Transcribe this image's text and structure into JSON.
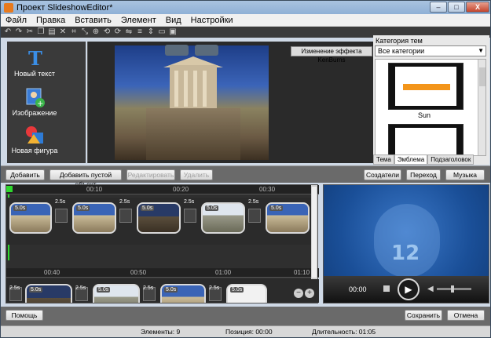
{
  "window": {
    "title": "Проект SlideshowEditor*",
    "min_label": "–",
    "max_label": "□",
    "close_label": "X"
  },
  "menu": [
    "Файл",
    "Правка",
    "Вставить",
    "Элемент",
    "Вид",
    "Настройки"
  ],
  "toolbar_icons": [
    "undo-icon",
    "redo-icon",
    "cut-icon",
    "copy-icon",
    "paste-icon",
    "delete-icon",
    "crop-icon",
    "resize-icon",
    "zoom-icon",
    "rotate-left-icon",
    "rotate-right-icon",
    "flip-icon",
    "align-icon",
    "distribute-icon",
    "send-back-icon",
    "bring-front-icon"
  ],
  "tools": [
    {
      "label": "Новый текст",
      "icon": "text-icon"
    },
    {
      "label": "Изображение",
      "icon": "image-icon"
    },
    {
      "label": "Новая фигура",
      "icon": "shape-icon"
    }
  ],
  "preview": {
    "kenburns_label": "Изменение эффекта KenBurns"
  },
  "themes": {
    "category_label": "Категория тем",
    "category_value": "Все категории",
    "items": [
      {
        "name": "Sun"
      },
      {
        "name": ""
      }
    ],
    "tabs": [
      "Тема",
      "Эмблема",
      "Подзаголовок"
    ]
  },
  "actions": {
    "add": "Добавить",
    "add_empty": "Добавить пустой объект",
    "edit": "Редактировать",
    "remove": "Удалить",
    "creators": "Создатели",
    "transition": "Переход",
    "music": "Музыка"
  },
  "timeline": {
    "ruler_top": [
      "00:10",
      "00:20",
      "00:30"
    ],
    "ruler_bottom": [
      "00:40",
      "00:50",
      "01:00",
      "01:10"
    ],
    "row1": [
      {
        "dur": "5.0s",
        "t": "2.5s"
      },
      {
        "dur": "5.0s",
        "t": "2.5s"
      },
      {
        "dur": "5.0s",
        "t": "2.5s"
      },
      {
        "dur": "5.0s",
        "t": "2.5s"
      },
      {
        "dur": "5.0s",
        "t": ""
      }
    ],
    "row2": [
      {
        "dur": "5.0s",
        "t": "2.5s"
      },
      {
        "dur": "5.0s",
        "t": "2.5s"
      },
      {
        "dur": "5.0s",
        "t": "2.5s"
      },
      {
        "dur": "5.0s",
        "t": "2.5s"
      },
      {
        "dur": "5.0s",
        "t": ""
      }
    ],
    "zoom_out": "−",
    "zoom_in": "+"
  },
  "player": {
    "time": "00:00",
    "logo_text": "12"
  },
  "bottom": {
    "help": "Помощь",
    "save": "Сохранить",
    "cancel": "Отмена"
  },
  "status": {
    "elements": "Элементы: 9",
    "position": "Позиция: 00:00",
    "duration": "Длительность: 01:05"
  }
}
